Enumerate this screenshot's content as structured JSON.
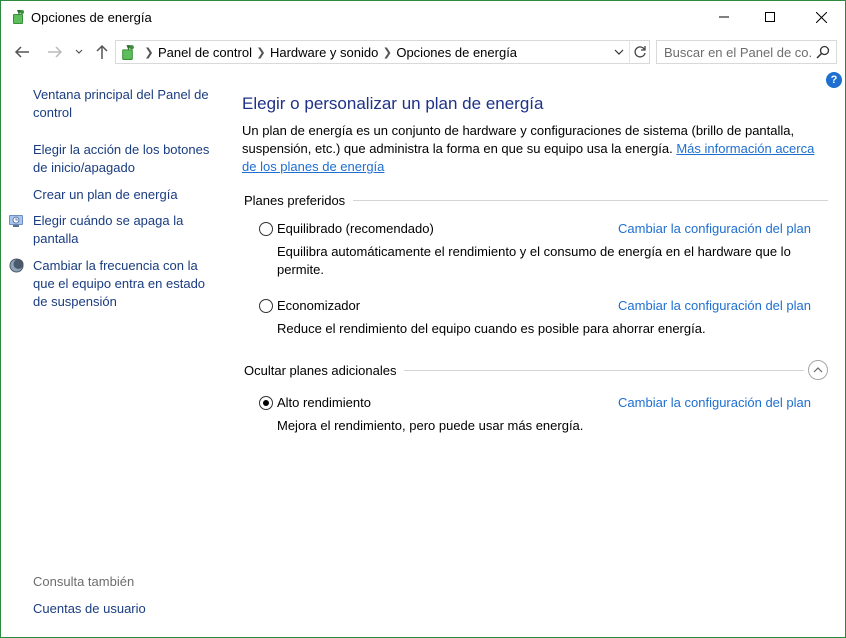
{
  "window": {
    "title": "Opciones de energía"
  },
  "nav": {
    "breadcrumbs": [
      "Panel de control",
      "Hardware y sonido",
      "Opciones de energía"
    ],
    "search_placeholder": "Buscar en el Panel de co..."
  },
  "sidebar": {
    "items": [
      {
        "label": "Ventana principal del Panel de control"
      },
      {
        "label": "Elegir la acción de los botones de inicio/apagado"
      },
      {
        "label": "Crear un plan de energía"
      },
      {
        "label": "Elegir cuándo se apaga la pantalla",
        "icon": "monitor-clock-icon"
      },
      {
        "label": "Cambiar la frecuencia con la que el equipo entra en estado de suspensión",
        "icon": "moon-sleep-icon"
      }
    ],
    "see_also": "Consulta también",
    "user_accounts": "Cuentas de usuario"
  },
  "main": {
    "title": "Elegir o personalizar un plan de energía",
    "intro_text": "Un plan de energía es un conjunto de hardware y configuraciones de sistema (brillo de pantalla, suspensión, etc.) que administra la forma en que su equipo usa la energía.",
    "intro_link": "Más información acerca de los planes de energía",
    "preferred_header": "Planes preferidos",
    "hidden_header": "Ocultar planes adicionales",
    "change_label": "Cambiar la configuración del plan",
    "plans": [
      {
        "name": "Equilibrado (recomendado)",
        "desc": "Equilibra automáticamente el rendimiento y el consumo de energía en el hardware que lo permite.",
        "checked": false
      },
      {
        "name": "Economizador",
        "desc": "Reduce el rendimiento del equipo cuando es posible para ahorrar energía.",
        "checked": false
      },
      {
        "name": "Alto rendimiento",
        "desc": "Mejora el rendimiento, pero puede usar más energía.",
        "checked": true
      }
    ]
  },
  "colors": {
    "link": "#1e6fd0",
    "title": "#1e3287",
    "nav_link": "#1a3c80",
    "border": "#2b8a3e"
  }
}
